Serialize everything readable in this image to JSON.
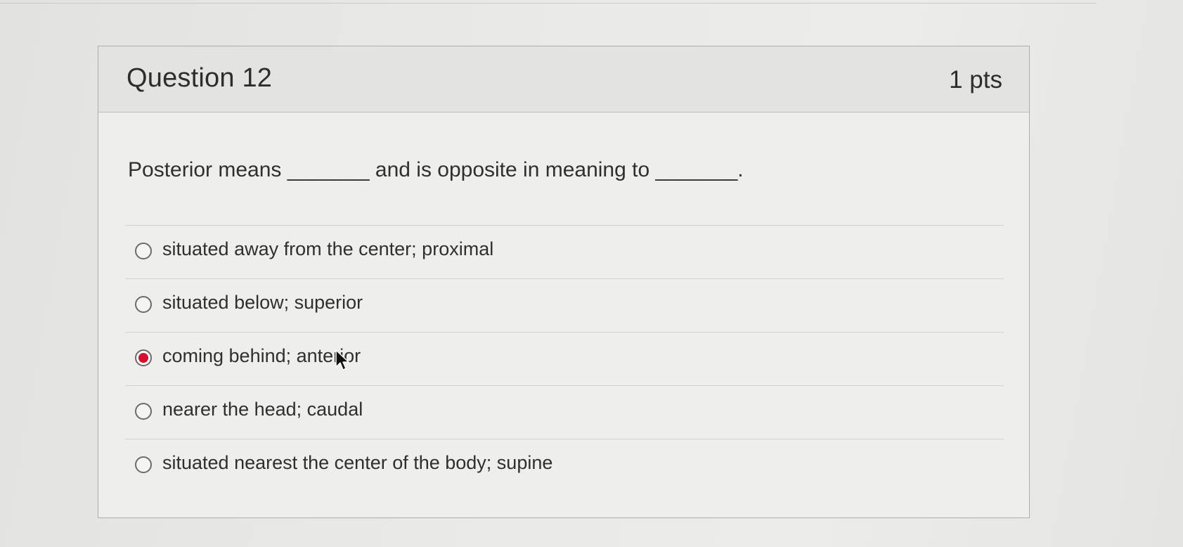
{
  "question": {
    "title": "Question 12",
    "points": "1 pts",
    "text": "Posterior means _______ and is opposite in meaning to _______."
  },
  "answers": [
    {
      "label": "situated away from the center; proximal",
      "selected": false
    },
    {
      "label": "situated below; superior",
      "selected": false
    },
    {
      "label": "coming behind; anterior",
      "selected": true
    },
    {
      "label": "nearer the head; caudal",
      "selected": false
    },
    {
      "label": "situated nearest the center of the body; supine",
      "selected": false
    }
  ],
  "colors": {
    "selected_radio": "#d60f2e"
  },
  "icons": {
    "cursor": "mouse-pointer-icon"
  }
}
